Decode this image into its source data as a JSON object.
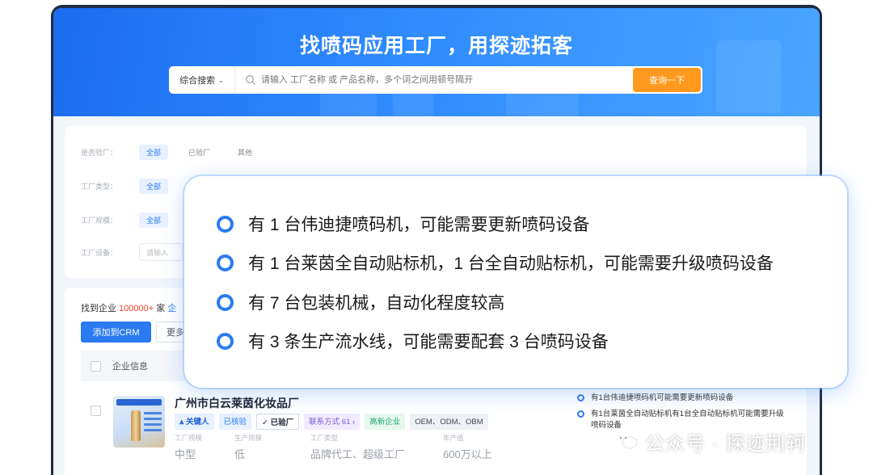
{
  "hero": {
    "title": "找喷码应用工厂，用探迹拓客"
  },
  "search": {
    "scope_label": "综合搜索",
    "placeholder": "请输入 工厂名称 或 产品名称，多个词之间用顿号隔开",
    "button_label": "查询一下"
  },
  "filters": {
    "row1": {
      "label": "是否验厂：",
      "chips": [
        "全部",
        "已验厂",
        "其他"
      ]
    },
    "row2": {
      "label": "工厂类型：",
      "chips": [
        "全部"
      ]
    },
    "row3": {
      "label": "工厂规模：",
      "chips": [
        "全部"
      ]
    },
    "row4": {
      "label": "工厂设备：",
      "input_placeholder": "请输入"
    }
  },
  "results": {
    "found_prefix": "找到企业",
    "found_count": "100000+",
    "found_suffix": "家",
    "found_link_fragment": "企",
    "add_crm_label": "添加到CRM",
    "more_label": "更多",
    "column_company": "企业信息"
  },
  "company": {
    "name": "广州市白云莱茵化妆品厂",
    "tags": [
      "关键人",
      "已核验",
      "已验厂",
      "联系方式 61",
      "高新企业",
      "OEM、ODM、OBM"
    ],
    "meta_labels": [
      "工厂规模",
      "生产规模",
      "工厂类型",
      "年产值"
    ],
    "meta_values": [
      "中型",
      "低",
      "品牌代工、超级工厂",
      "600万以上"
    ],
    "insights": [
      "有1台伟迪捷喷码机可能需要更新喷码设备",
      "有1台莱茵全自动贴标机有1台全自动贴标机可能需要升级喷码设备"
    ]
  },
  "popup": {
    "items": [
      "有 1 台伟迪捷喷码机，可能需要更新喷码设备",
      "有 1 台莱茵全自动贴标机，1 台全自动贴标机，可能需要升级喷码设备",
      "有 7 台包装机械，自动化程度较高",
      "有 3 条生产流水线，可能需要配套 3 台喷码设备"
    ]
  },
  "watermark": {
    "text": "公众号 · 探迹荆轲"
  },
  "colors": {
    "brand_blue": "#2a7bf2",
    "cta_orange": "#ff9a1f",
    "count_red": "#e8452c"
  }
}
